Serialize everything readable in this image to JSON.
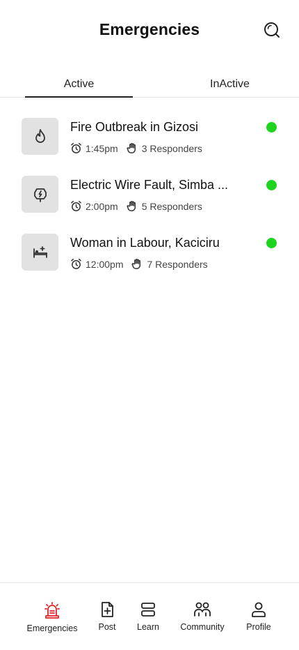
{
  "header": {
    "title": "Emergencies"
  },
  "tabs": [
    {
      "label": "Active",
      "selected": true
    },
    {
      "label": "InActive",
      "selected": false
    }
  ],
  "emergencies": [
    {
      "title": "Fire Outbreak in Gizosi",
      "time": "1:45pm",
      "responders": "3 Responders",
      "icon": "fire-icon",
      "status_color": "#1ed41e"
    },
    {
      "title": "Electric Wire Fault, Simba ...",
      "time": "2:00pm",
      "responders": "5 Responders",
      "icon": "electric-plug-icon",
      "status_color": "#1ed41e"
    },
    {
      "title": "Woman in Labour, Kaciciru",
      "time": "12:00pm",
      "responders": "7 Responders",
      "icon": "hospital-bed-icon",
      "status_color": "#1ed41e"
    }
  ],
  "bottom_nav": [
    {
      "label": "Emergencies",
      "icon": "siren-icon",
      "active": true
    },
    {
      "label": "Post",
      "icon": "file-plus-icon",
      "active": false
    },
    {
      "label": "Learn",
      "icon": "stack-icon",
      "active": false
    },
    {
      "label": "Community",
      "icon": "group-icon",
      "active": false
    },
    {
      "label": "Profile",
      "icon": "user-icon",
      "active": false
    }
  ],
  "colors": {
    "accent": "#e0262a",
    "status_active": "#1ed41e",
    "thumb_bg": "#e2e2e2"
  }
}
